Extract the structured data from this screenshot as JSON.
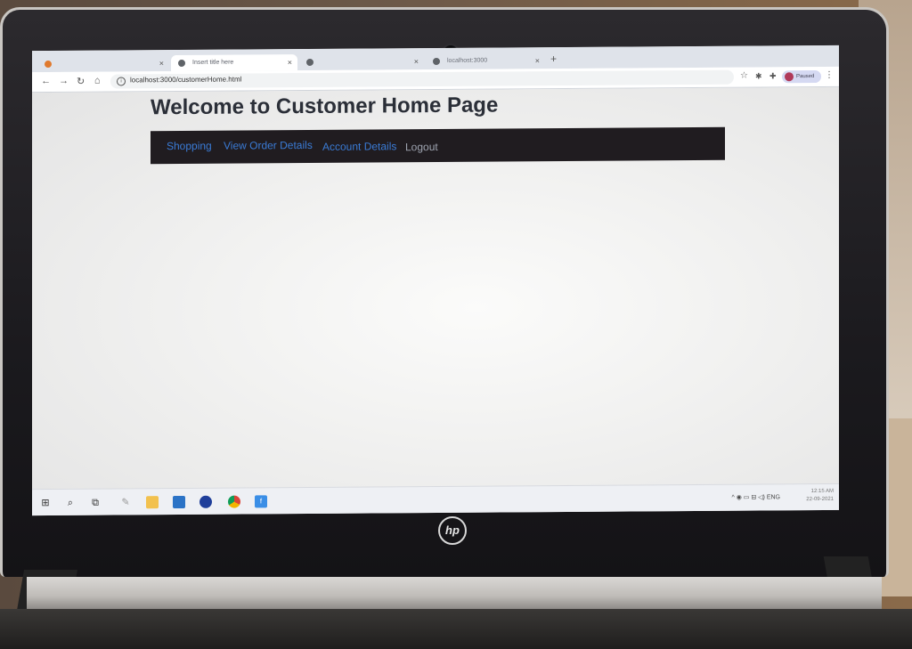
{
  "browser": {
    "tabs": [
      {
        "label": "",
        "active": false
      },
      {
        "label": "Insert title here",
        "active": true
      },
      {
        "label": "",
        "active": false
      },
      {
        "label": "localhost:3000",
        "active": false
      }
    ],
    "url": "localhost:3000/customerHome.html",
    "profile_label": "Paused"
  },
  "page": {
    "title": "Welcome to Customer Home Page",
    "nav": [
      {
        "label": "Shopping"
      },
      {
        "label": "View Order Details"
      },
      {
        "label": "Account Details"
      },
      {
        "label": "Logout"
      }
    ]
  },
  "taskbar": {
    "tray_lang": "ENG",
    "clock_time": "12:15 AM",
    "clock_date": "22-09-2021"
  },
  "device": {
    "brand_logo": "hp"
  },
  "colors": {
    "navbar_bg": "#201c20",
    "link_color": "#3a7bd5",
    "title_color": "#2b2f38"
  }
}
